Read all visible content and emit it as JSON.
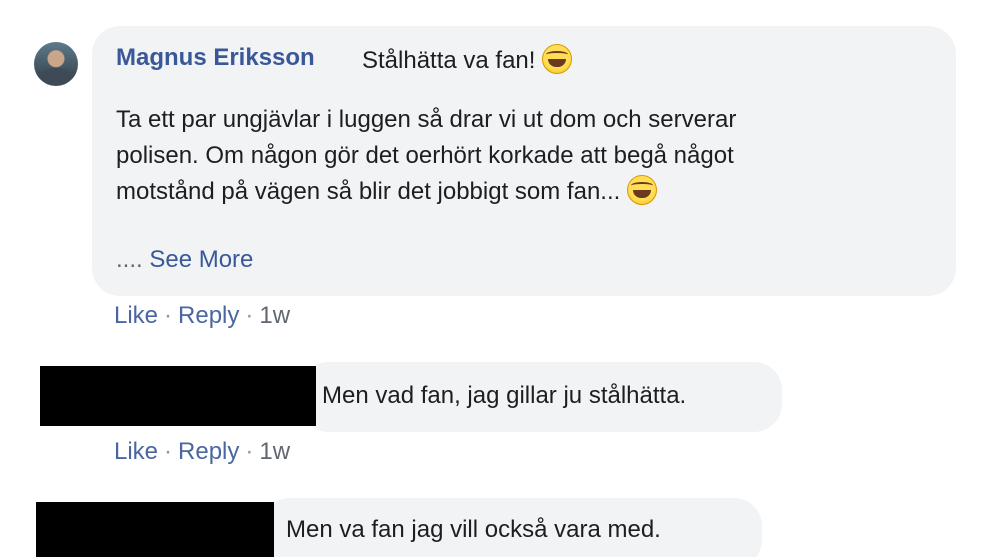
{
  "comments": [
    {
      "author": "Magnus Eriksson",
      "first_line": "Stålhätta va fan!",
      "body_lines": [
        "Ta ett par ungjävlar i luggen så drar vi ut dom och serverar",
        "polisen. Om någon gör det oerhört korkade att begå något",
        "motstånd på vägen så blir det jobbigt som fan..."
      ],
      "see_more_prefix": "....",
      "see_more": "See More",
      "emoji_icon": "laughing-tears-emoji",
      "actions": {
        "like": "Like",
        "reply": "Reply",
        "time": "1w",
        "sep": "·"
      }
    },
    {
      "text": "Men vad fan, jag gillar ju stålhätta.",
      "actions": {
        "like": "Like",
        "reply": "Reply",
        "time": "1w",
        "sep": "·"
      }
    },
    {
      "text": "Men va fan jag vill också vara med."
    }
  ],
  "colors": {
    "bubble": "#f2f3f5",
    "name": "#385898",
    "meta": "#606770",
    "link": "#4b67a1"
  }
}
